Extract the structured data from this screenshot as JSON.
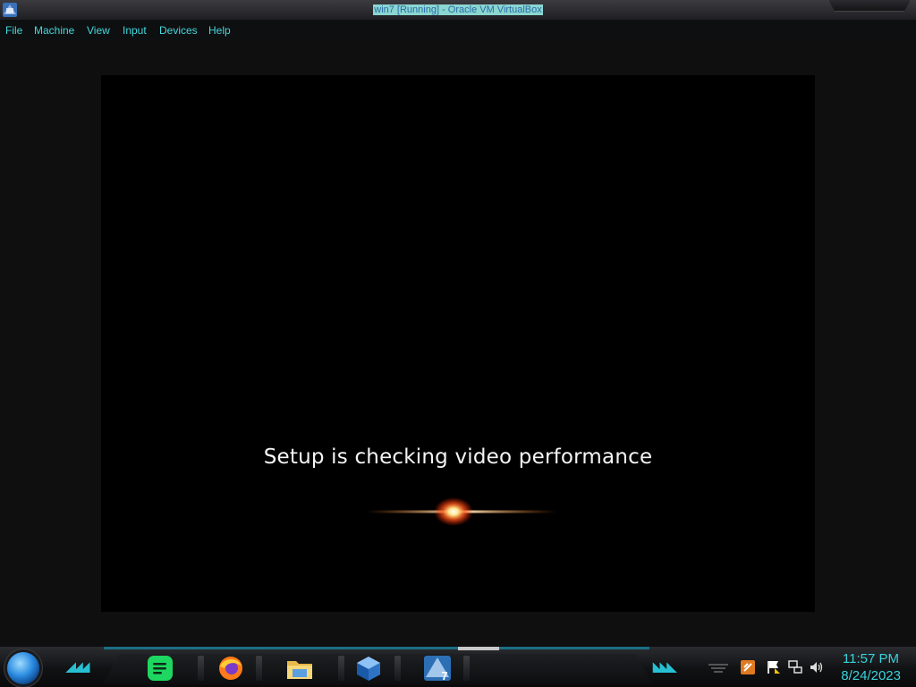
{
  "window": {
    "title": "win7 [Running] - Oracle VM VirtualBox",
    "icon": "virtualbox-icon"
  },
  "menu": {
    "items": [
      "File",
      "Machine",
      "View",
      "Input",
      "Devices",
      "Help"
    ]
  },
  "vm": {
    "status_text": "Setup is checking video performance"
  },
  "taskbar": {
    "start_icon": "start-orb",
    "pinned": [
      "spotify-icon",
      "firefox-icon",
      "file-explorer-icon",
      "virtualbox-icon",
      "virtualbox-win7-vm-icon"
    ],
    "active_badge": "7",
    "tray": [
      "notification-icon",
      "network-icon",
      "volume-icon"
    ],
    "clock": {
      "time": "11:57 PM",
      "date": "8/24/2023"
    }
  },
  "colors": {
    "accent": "#39d3dc",
    "menu_text": "#44d8dd",
    "vm_background": "#000000"
  }
}
